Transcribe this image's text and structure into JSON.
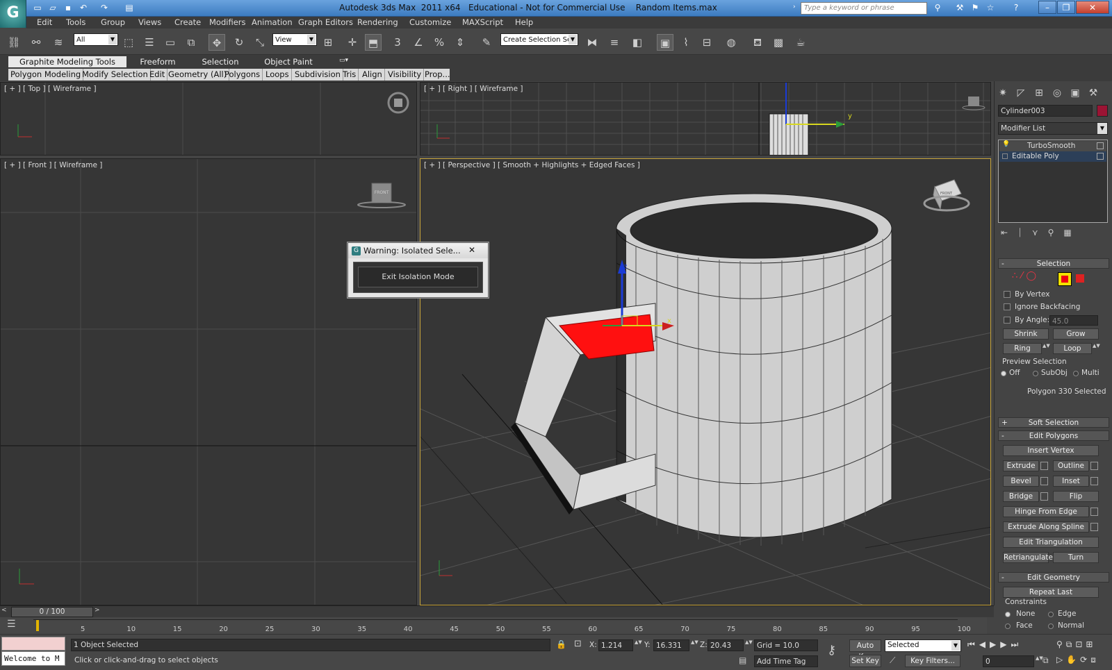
{
  "window": {
    "title": "Autodesk 3ds Max  2011 x64   Educational - Not for Commercial Use    Random Items.max",
    "search_placeholder": "Type a keyword or phrase"
  },
  "menu": [
    "Edit",
    "Tools",
    "Group",
    "Views",
    "Create",
    "Modifiers",
    "Animation",
    "Graph Editors",
    "Rendering",
    "Customize",
    "MAXScript",
    "Help"
  ],
  "toolbar": {
    "selection_filter": "All",
    "ref_coord": "View",
    "named_selection": "Create Selection Se",
    "snap_label": "3"
  },
  "ribbon": {
    "tabs": [
      "Graphite Modeling Tools",
      "Freeform",
      "Selection",
      "Object Paint"
    ],
    "panels": [
      "Polygon Modeling",
      "Modify Selection",
      "Edit",
      "Geometry (All)",
      "Polygons",
      "Loops",
      "Subdivision",
      "Tris",
      "Align",
      "Visibility",
      "Prop..."
    ]
  },
  "viewports": {
    "top": "[ + ] [ Top ] [ Wireframe ]",
    "right": "[ + ] [ Right ] [ Wireframe ]",
    "front": "[ + ] [ Front ] [ Wireframe ]",
    "perspective": "[ + ] [ Perspective ] [ Smooth + Highlights + Edged Faces ]",
    "front_cube_text": "FRONT",
    "persp_cube_text": "FRONT",
    "axis_x": "x",
    "axis_y": "y",
    "axis_z": "z"
  },
  "dialog": {
    "title": "Warning: Isolated Sele...",
    "button": "Exit Isolation Mode",
    "close": "✕"
  },
  "command_panel": {
    "object_name": "Cylinder003",
    "object_color": "#9b1434",
    "modifier_list": "Modifier List",
    "stack": [
      "TurboSmooth",
      "Editable Poly"
    ],
    "selection": {
      "title": "Selection",
      "by_vertex": "By Vertex",
      "ignore_backfacing": "Ignore Backfacing",
      "by_angle": "By Angle:",
      "angle_value": "45.0",
      "shrink": "Shrink",
      "grow": "Grow",
      "ring": "Ring",
      "loop": "Loop",
      "preview": "Preview Selection",
      "off": "Off",
      "subobj": "SubObj",
      "multi": "Multi",
      "status": "Polygon 330 Selected"
    },
    "soft_selection": "Soft Selection",
    "edit_polygons": {
      "title": "Edit Polygons",
      "insert_vertex": "Insert Vertex",
      "extrude": "Extrude",
      "outline": "Outline",
      "bevel": "Bevel",
      "inset": "Inset",
      "bridge": "Bridge",
      "flip": "Flip",
      "hinge": "Hinge From Edge",
      "extrude_spline": "Extrude Along Spline",
      "edit_tri": "Edit Triangulation",
      "retriangulate": "Retriangulate",
      "turn": "Turn"
    },
    "edit_geometry": {
      "title": "Edit Geometry",
      "repeat_last": "Repeat Last",
      "constraints": "Constraints",
      "none": "None",
      "edge": "Edge",
      "face": "Face",
      "normal": "Normal"
    }
  },
  "timeline": {
    "frame": "0 / 100",
    "ticks": [
      "5",
      "10",
      "15",
      "20",
      "25",
      "30",
      "35",
      "40",
      "45",
      "50",
      "55",
      "60",
      "65",
      "70",
      "75",
      "80",
      "85",
      "90",
      "95",
      "100"
    ]
  },
  "status": {
    "maxscript": "Welcome to M",
    "selected": "1 Object Selected",
    "prompt": "Click or click-and-drag to select objects",
    "x_label": "X:",
    "x": "1.214",
    "y_label": "Y:",
    "y": "16.331",
    "z_label": "Z:",
    "z": "20.43",
    "grid": "Grid = 10.0",
    "auto_key": "Auto Key",
    "set_key": "Set Key",
    "key_mode": "Selected",
    "key_filters": "Key Filters...",
    "add_time_tag": "Add Time Tag",
    "frame_field": "0"
  }
}
